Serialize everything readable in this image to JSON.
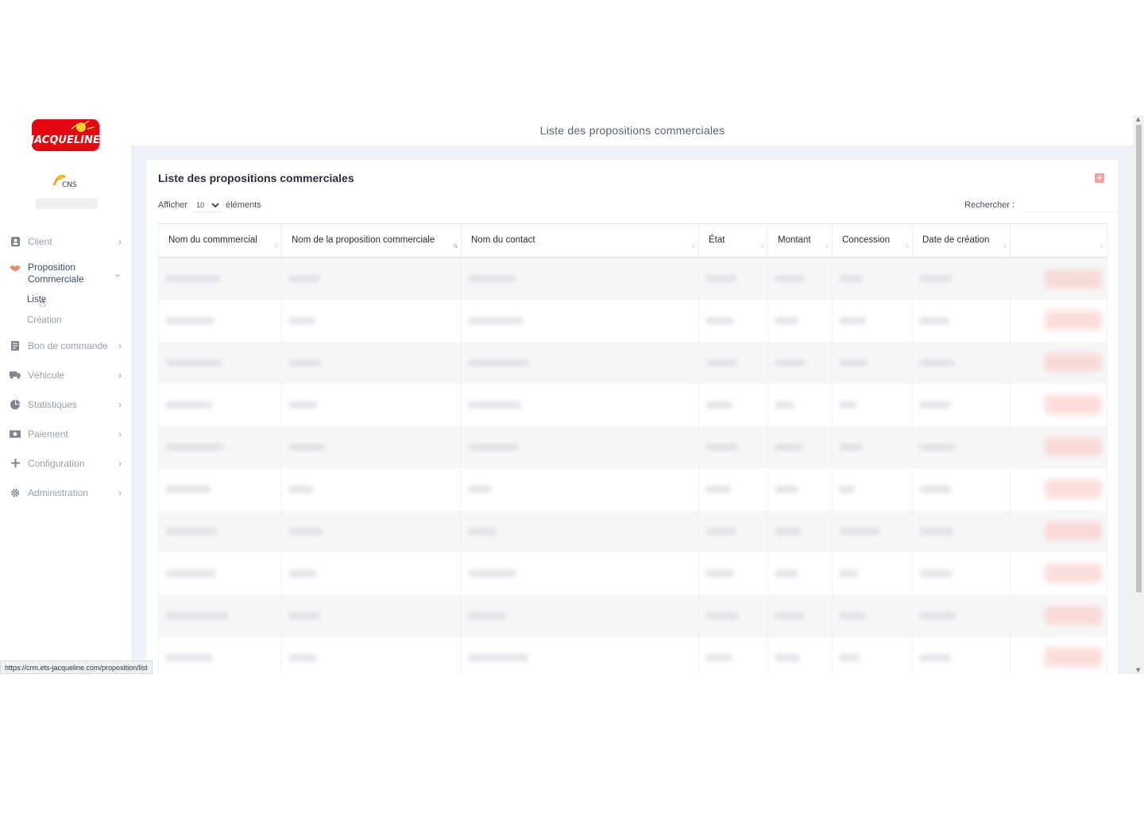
{
  "brand": {
    "logo_text": "JACQUELINE",
    "sub_logo_text": "CNS",
    "accent": "#e30613"
  },
  "sidebar": {
    "items": [
      {
        "label": "Client",
        "icon": "contact-card-icon"
      },
      {
        "label": "Proposition Commerciale",
        "icon": "handshake-icon",
        "open": true,
        "children": [
          {
            "label": "Liste",
            "active": true
          },
          {
            "label": "Création"
          }
        ]
      },
      {
        "label": "Bon de commande",
        "icon": "document-icon"
      },
      {
        "label": "Véhicule",
        "icon": "truck-icon"
      },
      {
        "label": "Statistiques",
        "icon": "pie-chart-icon"
      },
      {
        "label": "Paiement",
        "icon": "money-icon"
      },
      {
        "label": "Configuration",
        "icon": "plus-icon"
      },
      {
        "label": "Administration",
        "icon": "gear-icon"
      }
    ]
  },
  "header": {
    "title": "Liste des propositions commerciales"
  },
  "card": {
    "title": "Liste des propositions commerciales",
    "length_prefix": "Afficher",
    "length_value": "10",
    "length_suffix": "éléments",
    "search_label": "Rechercher :",
    "search_placeholder": ""
  },
  "table": {
    "columns": [
      "Nom du commmercial",
      "Nom de la proposition commerciale",
      "Nom du contact",
      "État",
      "Montant",
      "Concession",
      "Date de création",
      ""
    ],
    "row_count": 10
  },
  "status_bar": {
    "url": "https://crm.ets-jacqueline.com/proposition/list"
  }
}
